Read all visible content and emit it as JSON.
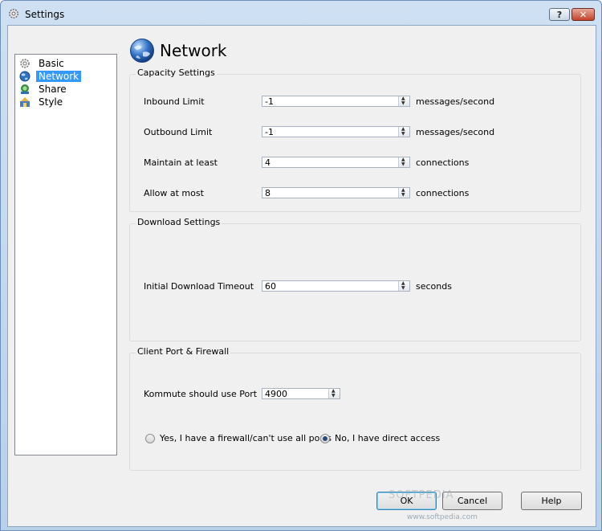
{
  "window": {
    "title": "Settings",
    "help_label": "?",
    "close_label": "✕"
  },
  "nav": {
    "items": [
      {
        "label": "Basic",
        "icon": "gear-icon"
      },
      {
        "label": "Network",
        "icon": "globe-icon"
      },
      {
        "label": "Share",
        "icon": "share-icon"
      },
      {
        "label": "Style",
        "icon": "style-icon"
      }
    ],
    "selected": "Network"
  },
  "page": {
    "title": "Network"
  },
  "capacity": {
    "title": "Capacity Settings",
    "inbound": {
      "label": "Inbound Limit",
      "value": "-1",
      "unit": "messages/second"
    },
    "outbound": {
      "label": "Outbound Limit",
      "value": "-1",
      "unit": "messages/second"
    },
    "maintain": {
      "label": "Maintain at least",
      "value": "4",
      "unit": "connections"
    },
    "allow": {
      "label": "Allow at most",
      "value": "8",
      "unit": "connections"
    }
  },
  "download": {
    "title": "Download Settings",
    "timeout": {
      "label": "Initial Download Timeout",
      "value": "60",
      "unit": "seconds"
    }
  },
  "port": {
    "title": "Client Port & Firewall",
    "port_field": {
      "label": "Kommute should use Port",
      "value": "4900"
    },
    "radio_firewall": "Yes, I have a firewall/can't use all ports",
    "radio_direct": "No, I have direct access",
    "selected": "direct"
  },
  "buttons": {
    "ok": "OK",
    "cancel": "Cancel",
    "help": "Help"
  },
  "watermark": {
    "brand": "SOFTPEDIA",
    "url": "www.softpedia.com"
  },
  "colors": {
    "selection": "#3399ff",
    "titlebar": "#c5d9f0"
  }
}
